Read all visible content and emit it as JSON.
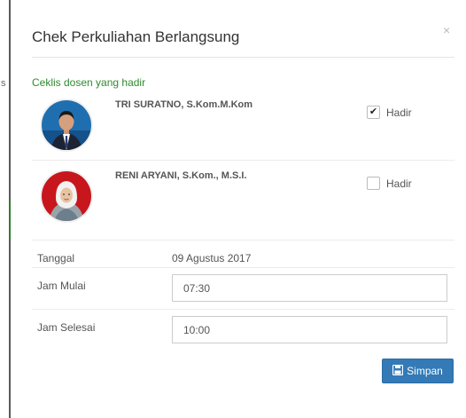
{
  "modal": {
    "title": "Chek Perkuliahan Berlangsung",
    "close_glyph": "×",
    "subtitle": "Ceklis dosen yang hadir"
  },
  "lecturers": [
    {
      "name": "TRI SURATNO, S.Kom.M.Kom",
      "present": true,
      "check_label": "Hadir",
      "check_glyph": "✔"
    },
    {
      "name": "RENI ARYANI, S.Kom., M.S.I.",
      "present": false,
      "check_label": "Hadir",
      "check_glyph": ""
    }
  ],
  "fields": {
    "tanggal_label": "Tanggal",
    "tanggal_value": "09 Agustus 2017",
    "jam_mulai_label": "Jam Mulai",
    "jam_mulai_value": "07:30",
    "jam_selesai_label": "Jam Selesai",
    "jam_selesai_value": "10:00"
  },
  "save_button": {
    "label": "Simpan",
    "icon": "save-icon"
  },
  "colors": {
    "primary": "#337ab7",
    "subtitle_green": "#2e8b2e",
    "avatar1_bg": "#1f6fb0",
    "avatar2_bg": "#c8161d"
  }
}
